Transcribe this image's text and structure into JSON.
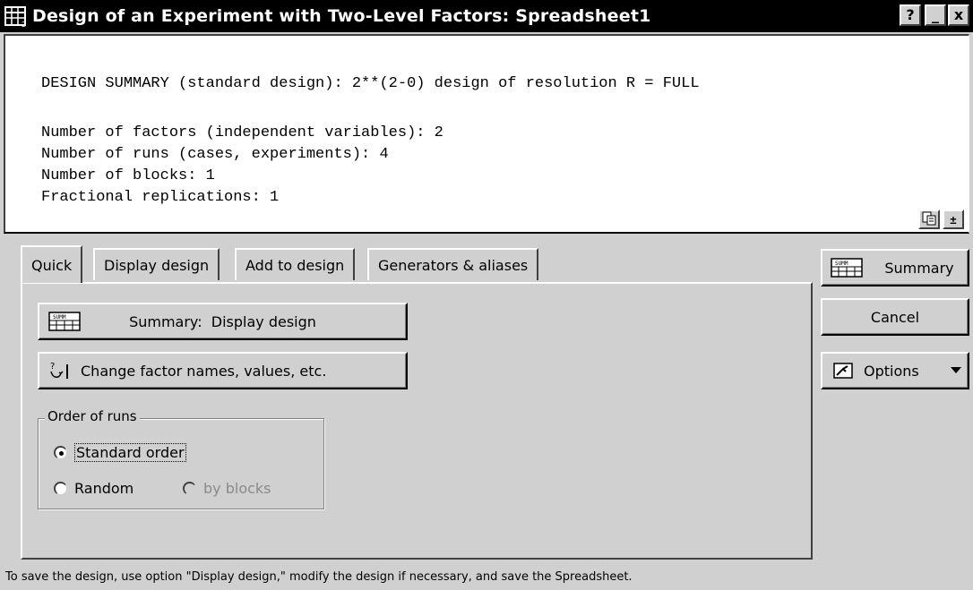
{
  "window": {
    "title": "Design of an Experiment with Two-Level Factors: Spreadsheet1",
    "help_button": "?",
    "minimize_button": "_",
    "close_button": "x",
    "app_icon": "spreadsheet-design-icon"
  },
  "summary": {
    "lines": [
      "DESIGN SUMMARY (standard design): 2**(2-0) design of resolution R = FULL",
      "Number of factors (independent variables): 2",
      "Number of runs (cases, experiments): 4",
      "Number of blocks: 1",
      "Fractional replications: 1"
    ],
    "copy_icon": "copy-icon",
    "expand_button": "±"
  },
  "tabs": [
    {
      "label": "Quick",
      "active": true
    },
    {
      "label": "Display design",
      "active": false
    },
    {
      "label": "Add to design",
      "active": false
    },
    {
      "label": "Generators & aliases",
      "active": false
    }
  ],
  "quick": {
    "summary_display_button": "Summary:  Display design",
    "change_factor_button": "Change factor names, values, etc.",
    "order_group_title": "Order of runs",
    "standard_order": "Standard order",
    "random": "Random",
    "by_blocks": "by blocks",
    "selected_order": "Standard order"
  },
  "side_buttons": {
    "summary": "Summary",
    "cancel": "Cancel",
    "options": "Options"
  },
  "status_text": "To save the design, use option \"Display design,\" modify the design if necessary, and save the Spreadsheet."
}
